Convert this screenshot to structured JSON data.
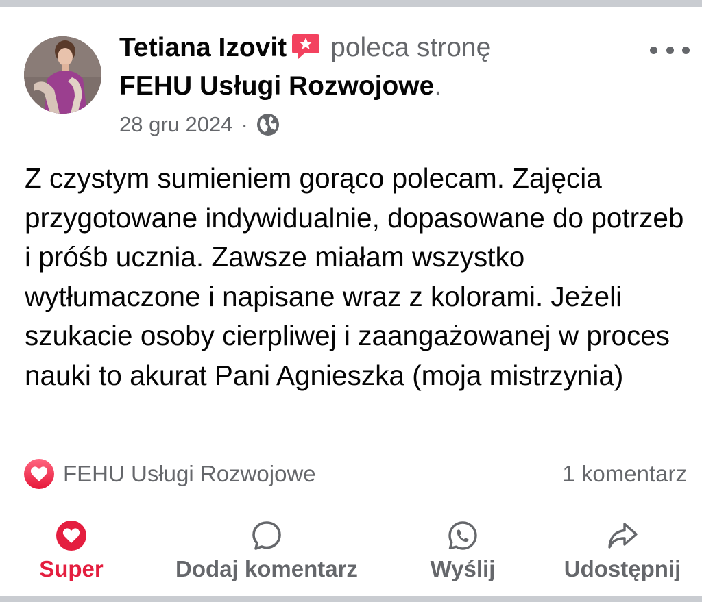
{
  "post": {
    "author": "Tetiana Izovit",
    "action_text": "poleca stronę",
    "page_name": "FEHU Usługi Rozwojowe",
    "page_name_suffix": ".",
    "date": "28 gru 2024",
    "meta_separator": "·",
    "audience_icon": "globe-icon",
    "recommend_badge_icon": "recommend-star-icon",
    "body": "Z czystym sumieniem gorąco polecam. Zajęcia przygotowane indywidualnie, dopasowane do potrzeb i próśb ucznia. Zawsze miałam wszystko wytłumaczone i napisane wraz z kolorami. Jeżeli szukacie osoby cierpliwej i zaangażowanej w proces nauki to akurat Pani Agnieszka (moja mistrzynia)"
  },
  "reactions": {
    "icon": "love-reaction-icon",
    "reactor": "FEHU Usługi Rozwojowe",
    "comment_count": "1 komentarz"
  },
  "actions": [
    {
      "id": "super",
      "label": "Super",
      "icon": "love-icon",
      "active": true
    },
    {
      "id": "comment",
      "label": "Dodaj komentarz",
      "icon": "comment-icon",
      "active": false
    },
    {
      "id": "send",
      "label": "Wyślij",
      "icon": "whatsapp-icon",
      "active": false
    },
    {
      "id": "share",
      "label": "Udostępnij",
      "icon": "share-icon",
      "active": false
    }
  ],
  "colors": {
    "primary_text": "#050505",
    "secondary_text": "#65676b",
    "love_red": "#e41e3f",
    "recommend_pink": "#f3425f",
    "frame_gray": "#c9ccd1"
  }
}
